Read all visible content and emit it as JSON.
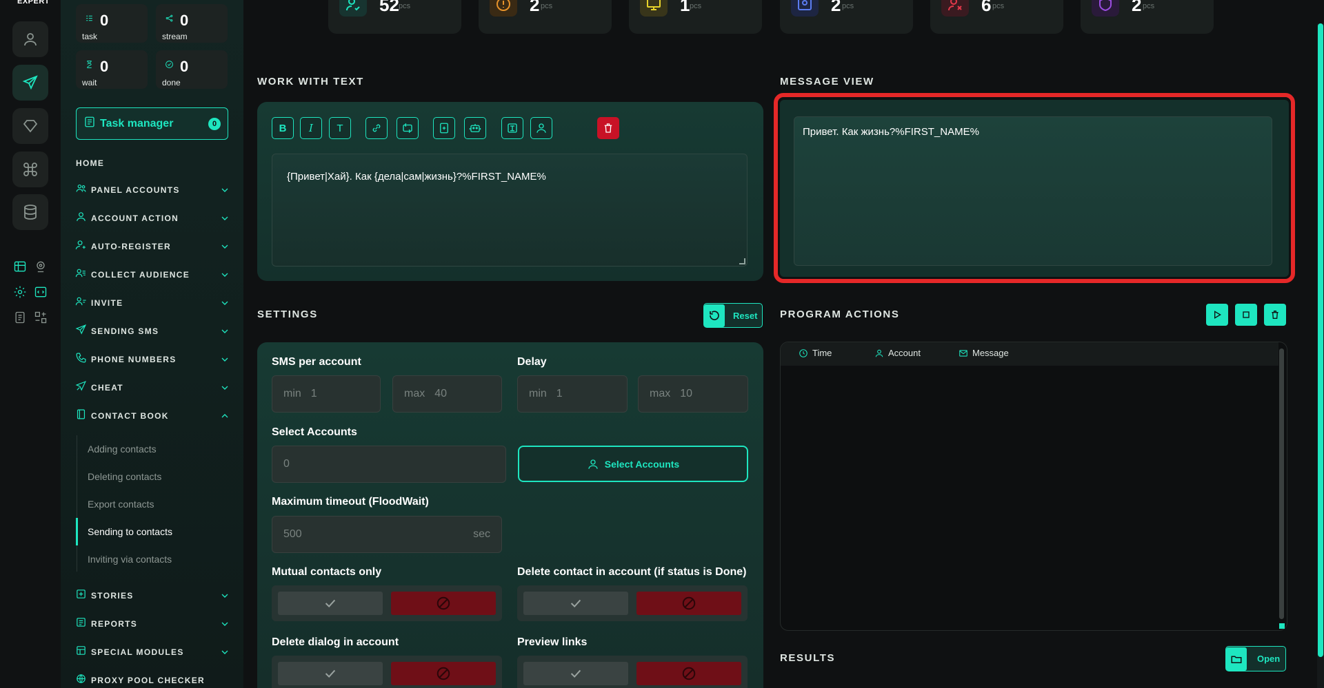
{
  "brand": "EXPERT",
  "stats": [
    {
      "value": "0",
      "label": "task",
      "icon": "task-list-icon"
    },
    {
      "value": "0",
      "label": "stream",
      "icon": "stream-icon"
    },
    {
      "value": "0",
      "label": "wait",
      "icon": "hourglass-icon"
    },
    {
      "value": "0",
      "label": "done",
      "icon": "check-circle-icon"
    }
  ],
  "task_manager": {
    "label": "Task manager",
    "badge": "0"
  },
  "nav": {
    "home": "HOME",
    "items": [
      "PANEL ACCOUNTS",
      "ACCOUNT ACTION",
      "AUTO-REGISTER",
      "COLLECT AUDIENCE",
      "INVITE",
      "SENDING SMS",
      "PHONE NUMBERS",
      "CHEAT",
      "CONTACT BOOK",
      "STORIES",
      "REPORTS",
      "SPECIAL MODULES",
      "PROXY POOL CHECKER"
    ],
    "contact_book_sub": [
      "Adding contacts",
      "Deleting contacts",
      "Export contacts",
      "Sending to contacts",
      "Inviting via contacts"
    ],
    "active_sub": "Sending to contacts"
  },
  "top_cards": [
    {
      "value": "52",
      "unit": "pcs",
      "color": "#1ee6c0"
    },
    {
      "value": "2",
      "unit": "pcs",
      "color": "#e8932a"
    },
    {
      "value": "1",
      "unit": "pcs",
      "color": "#e8d32a"
    },
    {
      "value": "2",
      "unit": "pcs",
      "color": "#5b7cf0"
    },
    {
      "value": "6",
      "unit": "pcs",
      "color": "#e5384a"
    },
    {
      "value": "2",
      "unit": "pcs",
      "color": "#9b4de0"
    }
  ],
  "work_with_text": {
    "title": "WORK WITH TEXT",
    "toolbar": {
      "bold": "B",
      "italic": "I",
      "text": "T"
    },
    "content": "{Привет|Хай}. Как {дела|сам|жизнь}?%FIRST_NAME%"
  },
  "message_view": {
    "title": "MESSAGE VIEW",
    "content": "Привет. Как жизнь?%FIRST_NAME%"
  },
  "settings": {
    "title": "SETTINGS",
    "reset": "Reset",
    "sms_per_account": {
      "label": "SMS per account",
      "min_prefix": "min",
      "min": "1",
      "max_prefix": "max",
      "max": "40"
    },
    "delay": {
      "label": "Delay",
      "min_prefix": "min",
      "min": "1",
      "max_prefix": "max",
      "max": "10"
    },
    "select_accounts": {
      "label": "Select Accounts",
      "value": "0",
      "button": "Select Accounts"
    },
    "timeout": {
      "label": "Maximum timeout (FloodWait)",
      "value": "500",
      "unit": "sec"
    },
    "mutual": {
      "label": "Mutual contacts only"
    },
    "delete_contact": {
      "label": "Delete contact in account (if status is Done)"
    },
    "delete_dialog": {
      "label": "Delete dialog in account"
    },
    "preview_links": {
      "label": "Preview links"
    }
  },
  "program_actions": {
    "title": "PROGRAM ACTIONS",
    "columns": [
      "Time",
      "Account",
      "Message"
    ]
  },
  "results": {
    "title": "RESULTS",
    "open": "Open"
  }
}
